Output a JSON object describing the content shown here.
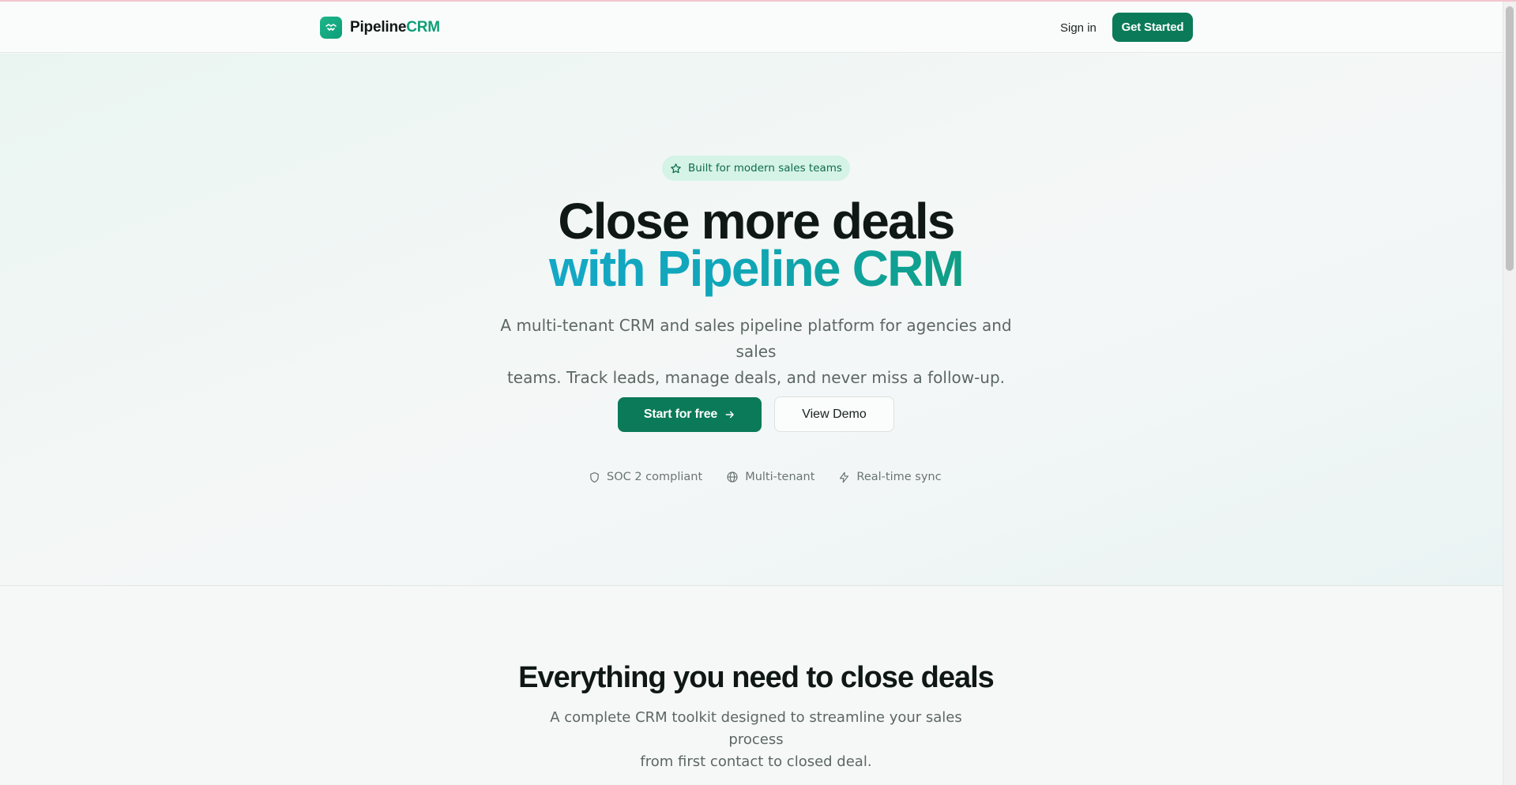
{
  "header": {
    "brand_prefix": "Pipeline",
    "brand_accent": "CRM",
    "signin_label": "Sign in",
    "get_started_label": "Get Started",
    "logo_icon": "handshake-icon"
  },
  "hero": {
    "badge_icon": "star-icon",
    "badge_text": "Built for modern sales teams",
    "title_line1": "Close more deals",
    "title_line2": "with Pipeline CRM",
    "subtitle_line1": "A multi-tenant CRM and sales pipeline platform for agencies and sales",
    "subtitle_line2": "teams. Track leads, manage deals, and never miss a follow-up.",
    "primary_button_label": "Start for free",
    "primary_button_icon": "arrow-right-icon",
    "secondary_button_label": "View Demo",
    "trust_items": [
      {
        "icon": "shield-icon",
        "label": "SOC 2 compliant"
      },
      {
        "icon": "globe-icon",
        "label": "Multi-tenant"
      },
      {
        "icon": "lightning-icon",
        "label": "Real-time sync"
      }
    ]
  },
  "features": {
    "title": "Everything you need to close deals",
    "subtitle_line1": "A complete CRM toolkit designed to streamline your sales process",
    "subtitle_line2": "from first contact to closed deal."
  },
  "colors": {
    "brand_green": "#0b7a58",
    "accent_green": "#0f9e77",
    "badge_bg": "#d5f3e6",
    "gradient_start": "#14a8c6",
    "gradient_end": "#0f9e84"
  }
}
